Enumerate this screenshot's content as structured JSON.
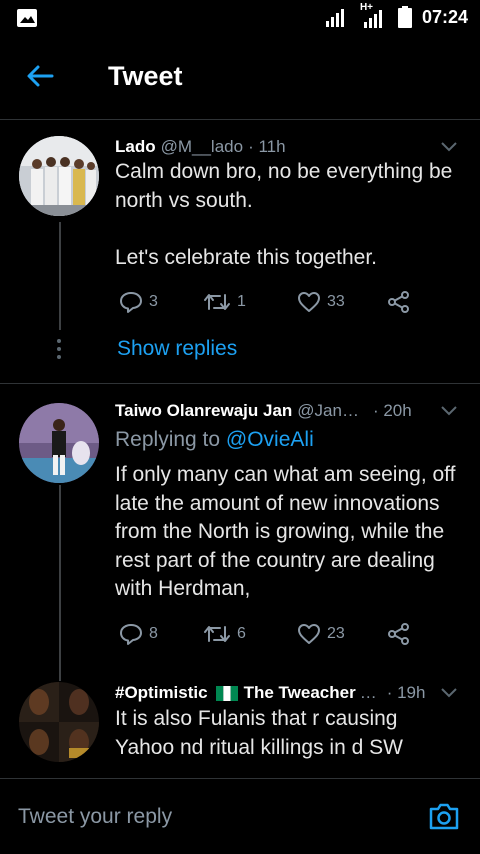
{
  "statusbar": {
    "network": "H+",
    "time": "07:24"
  },
  "appbar": {
    "title": "Tweet"
  },
  "tweets": [
    {
      "name": "Lado",
      "handle": "@M__lado",
      "time": "· 11h",
      "text": "Calm down bro, no be everything be north vs south.\n\nLet's celebrate this together.",
      "replies": "3",
      "retweets": "1",
      "likes": "33"
    },
    {
      "name": "Taiwo Olanrewaju Jan",
      "handle": "@Jan…",
      "time": "· 20h",
      "replying_prefix": "Replying to",
      "replying_to": "@OvieAli",
      "text": "If only many can what am seeing, off late the amount of new innovations from the North is growing,  while the rest part of the country are dealing with Herdman,",
      "replies": "8",
      "retweets": "6",
      "likes": "23"
    },
    {
      "name": "#Optimistic",
      "name_suffix": "The Tweacher",
      "ellipsis": "…",
      "time": "· 19h",
      "text": "It is also Fulanis that r causing Yahoo nd ritual killings in d SW"
    }
  ],
  "show_replies": "Show replies",
  "composer": {
    "placeholder": "Tweet your reply"
  },
  "colors": {
    "accent": "#1da1f2",
    "muted": "#8b98a5",
    "background": "#000000"
  }
}
